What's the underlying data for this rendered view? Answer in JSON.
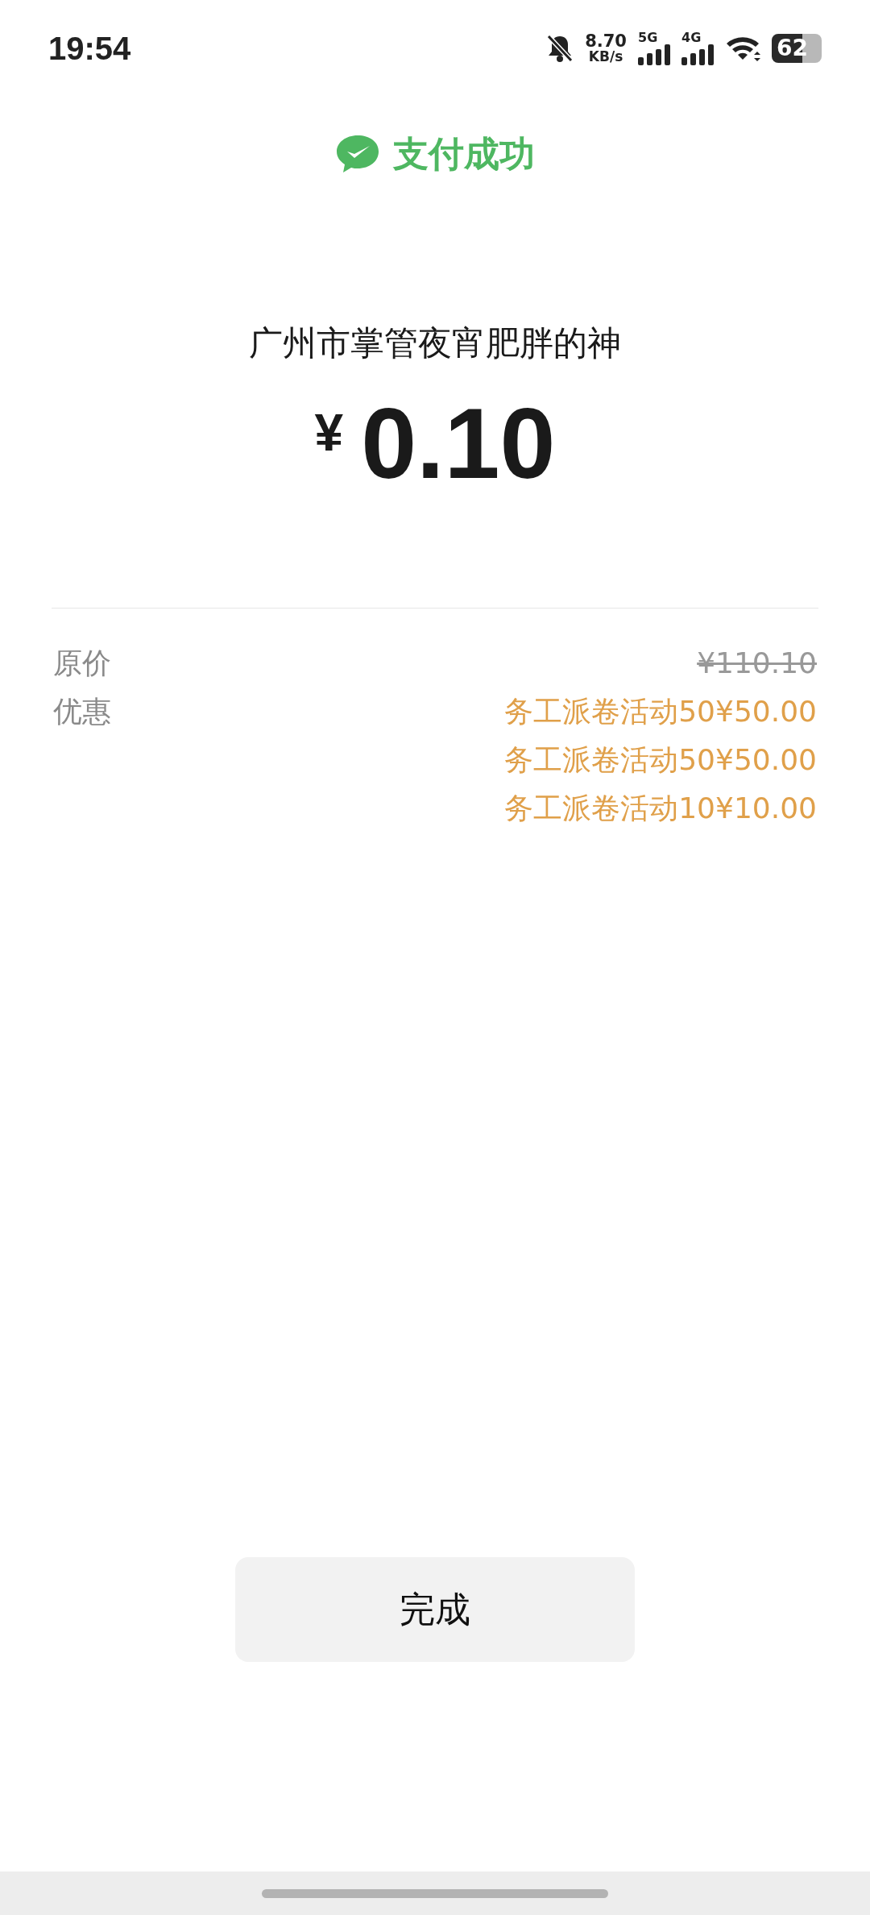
{
  "status_bar": {
    "time": "19:54",
    "net_speed": "8.70",
    "net_unit": "KB/s",
    "signals": [
      {
        "label": "5G"
      },
      {
        "label": "4G"
      }
    ],
    "battery": "62"
  },
  "header": {
    "title": "支付成功"
  },
  "payee": "广州市掌管夜宵肥胖的神",
  "amount": {
    "currency": "¥",
    "value": "0.10"
  },
  "details": [
    {
      "label": "原价",
      "values": [
        {
          "text": "¥110.10",
          "kind": "struck"
        }
      ]
    },
    {
      "label": "优惠",
      "values": [
        {
          "text": "务工派卷活动50¥50.00",
          "kind": "discount"
        },
        {
          "text": "务工派卷活动50¥50.00",
          "kind": "discount"
        },
        {
          "text": "务工派卷活动10¥10.00",
          "kind": "discount"
        }
      ]
    }
  ],
  "done_button": "完成"
}
